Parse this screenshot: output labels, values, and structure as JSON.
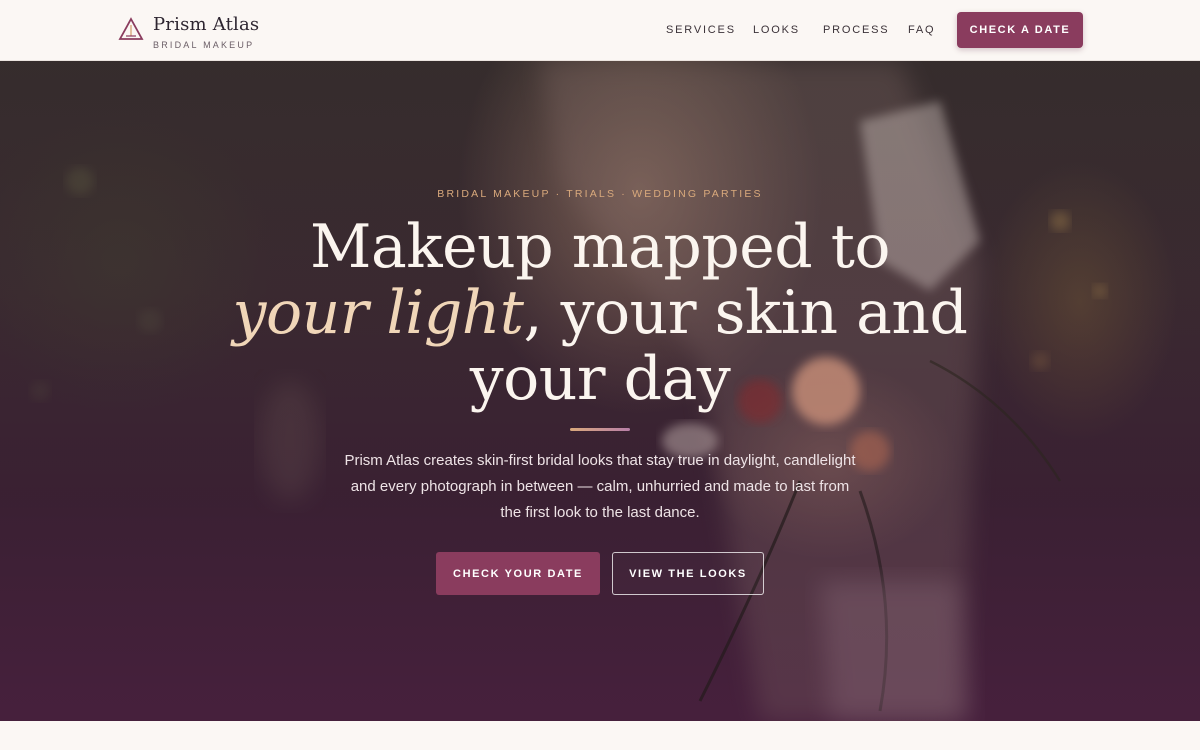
{
  "nav": {
    "brand_name": "Prism Atlas",
    "brand_sub": "BRIDAL MAKEUP",
    "links": [
      "SERVICES",
      "LOOKS",
      "PROCESS",
      "FAQ"
    ],
    "cta": "CHECK A DATE"
  },
  "hero": {
    "eyebrow": "BRIDAL MAKEUP · TRIALS · WEDDING PARTIES",
    "headline_line1": "Makeup mapped to",
    "headline_accent": "your light",
    "headline_rest": ", your skin and",
    "headline_line3": "your day",
    "lead": "Prism Atlas creates skin-first bridal looks that stay true in daylight, candlelight and every photograph in between — calm, unhurried and made to last from the first look to the last dance.",
    "primary_cta": "CHECK YOUR DATE",
    "secondary_cta": "VIEW THE LOOKS"
  },
  "colors": {
    "accent": "#8a3c5e",
    "eyebrow": "#d9a97c",
    "headline_accent": "#f0d6b8",
    "page_bg": "#fbf7f4"
  }
}
